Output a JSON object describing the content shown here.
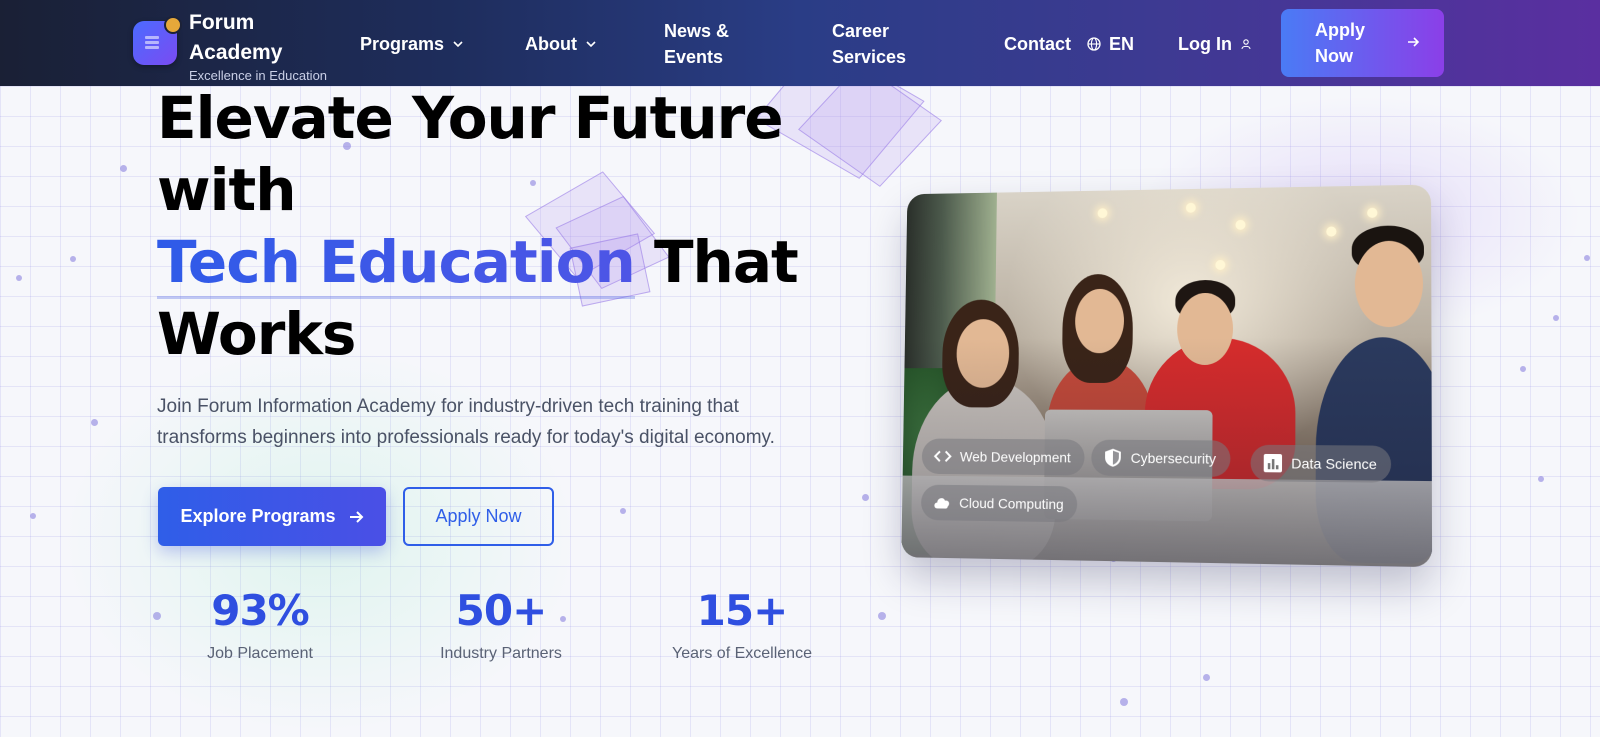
{
  "brand": {
    "name": "Forum Academy",
    "tagline": "Excellence in Education"
  },
  "nav": {
    "items": [
      {
        "label": "Programs",
        "dropdown": true
      },
      {
        "label": "About",
        "dropdown": true
      },
      {
        "label": "News & Events",
        "dropdown": false
      },
      {
        "label": "Career Services",
        "dropdown": false
      },
      {
        "label": "Contact",
        "dropdown": false
      }
    ],
    "language": "EN",
    "login": "Log In",
    "apply": "Apply Now"
  },
  "hero": {
    "title_line1": "Elevate Your Future with",
    "title_accent": "Tech Education",
    "title_line2": "That Works",
    "subtitle": "Join Forum Information Academy for industry-driven tech training that transforms beginners into professionals ready for today's digital economy.",
    "primary_cta": "Explore Programs",
    "secondary_cta": "Apply Now"
  },
  "stats": [
    {
      "value": "93%",
      "label": "Job Placement"
    },
    {
      "value": "50+",
      "label": "Industry Partners"
    },
    {
      "value": "15+",
      "label": "Years of Excellence"
    }
  ],
  "photo": {
    "tags": [
      {
        "label": "Web Development",
        "icon": "code-icon"
      },
      {
        "label": "Cybersecurity",
        "icon": "shield-icon"
      },
      {
        "label": "Data Science",
        "icon": "chart-icon"
      },
      {
        "label": "Cloud Computing",
        "icon": "cloud-icon"
      }
    ]
  },
  "colors": {
    "primary": "#2f5ee8",
    "accent_purple": "#8b3fe8",
    "header_dark": "#1a2035"
  }
}
